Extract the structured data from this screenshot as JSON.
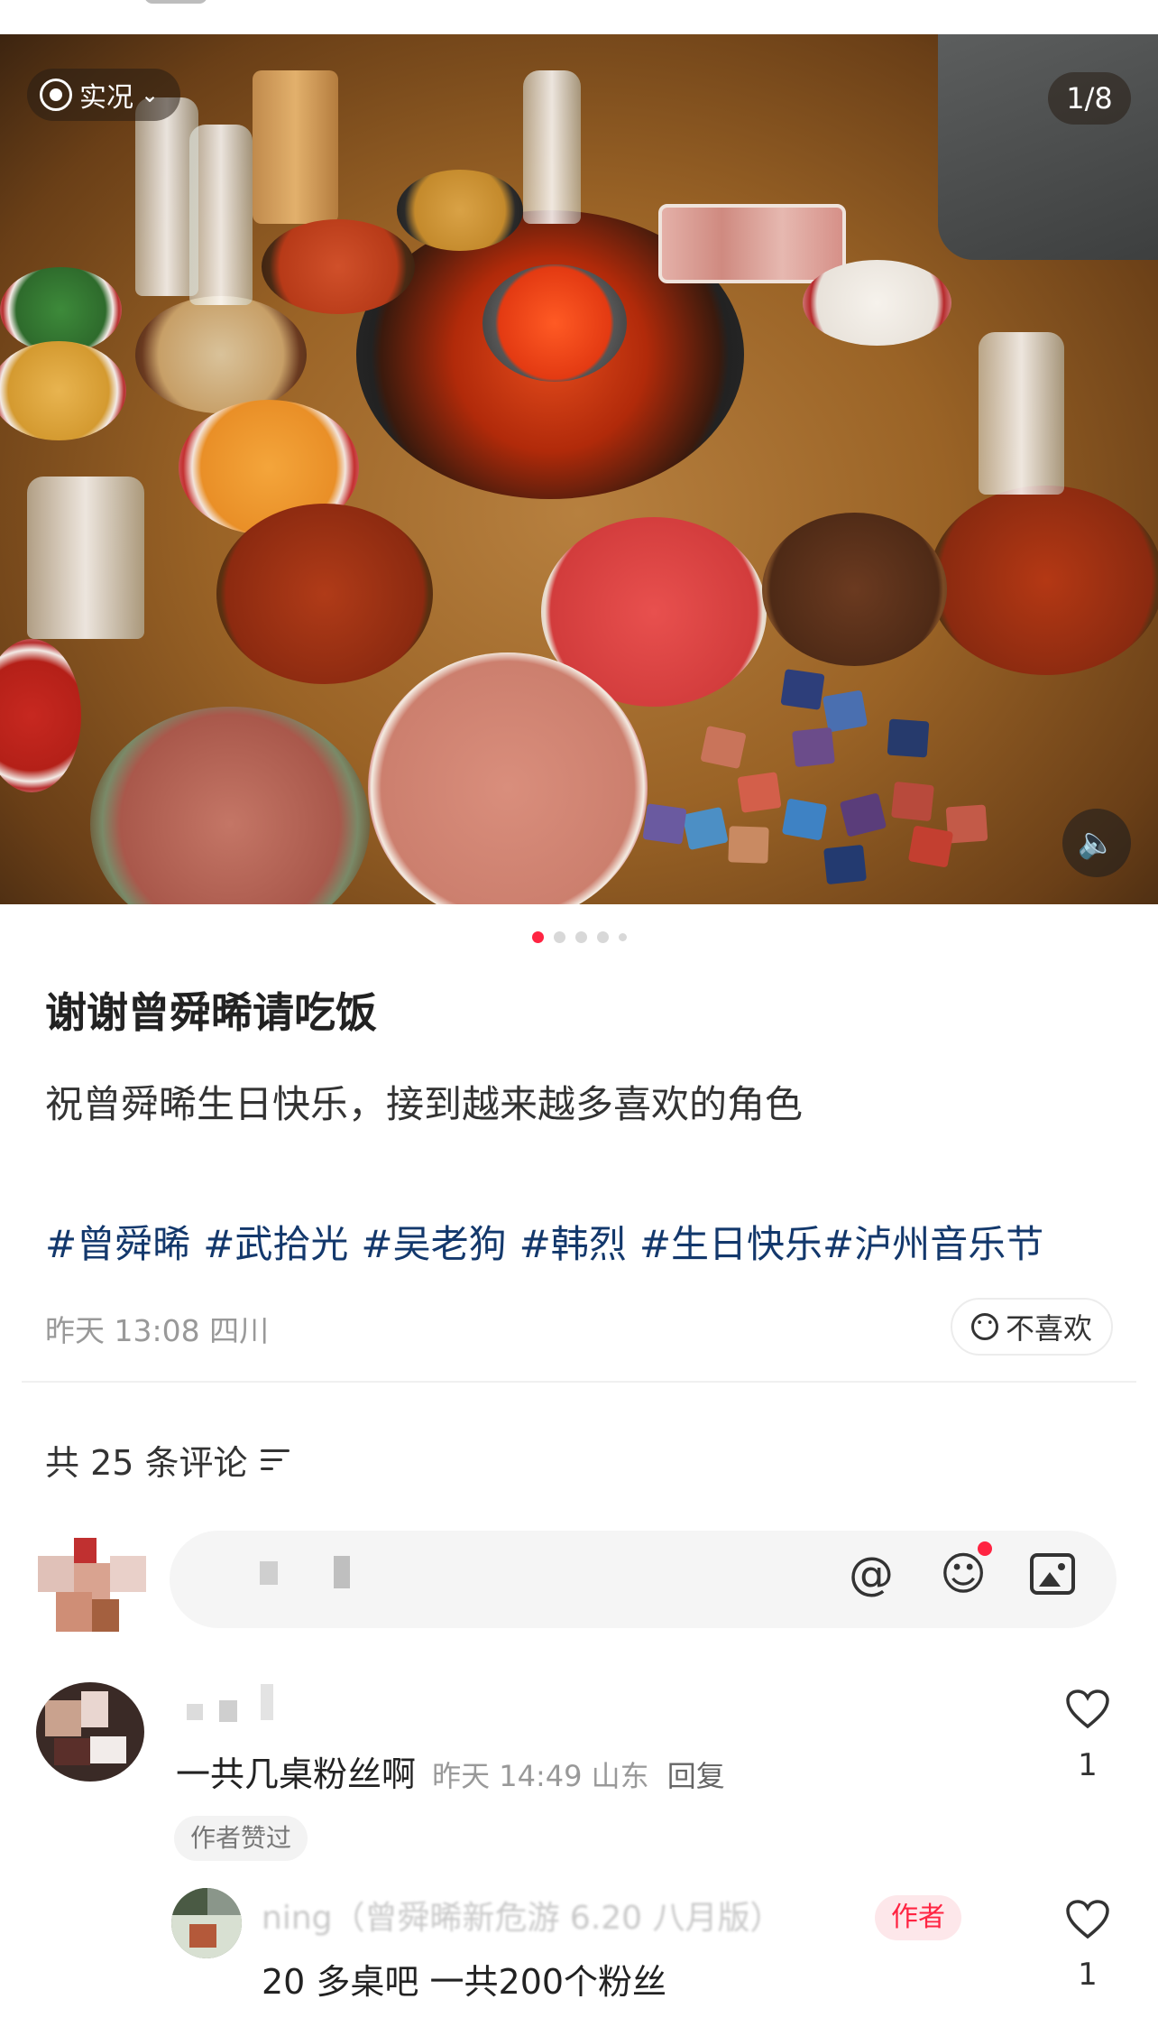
{
  "photo": {
    "live_label": "实况",
    "page_counter": "1/8",
    "total_pages": 8,
    "current_page": 1
  },
  "post": {
    "title": "谢谢曾舜晞请吃饭",
    "body": "祝曾舜晞生日快乐，接到越来越多喜欢的角色",
    "tags": [
      "#曾舜晞",
      "#武拾光",
      "#吴老狗",
      "#韩烈",
      "#生日快乐#泸州音乐节"
    ],
    "meta": "昨天 13:08 四川",
    "dislike_label": "不喜欢"
  },
  "comments_section": {
    "count_label": "共 25 条评论",
    "input_icons": [
      "at-icon",
      "emoji-icon",
      "image-icon"
    ]
  },
  "comments": [
    {
      "text": "一共几桌粉丝啊",
      "time_location": "昨天 14:49 山东",
      "reply_label": "回复",
      "author_liked_label": "作者赞过",
      "likes": "1"
    },
    {
      "name_partial": "ning（曾舜晞新危游 6.20 八月版）",
      "author_badge": "作者",
      "text": "20 多桌吧 一共200个粉丝",
      "likes": "1"
    }
  ],
  "colors": {
    "accent": "#ff2442",
    "tag_link": "#13386c"
  }
}
